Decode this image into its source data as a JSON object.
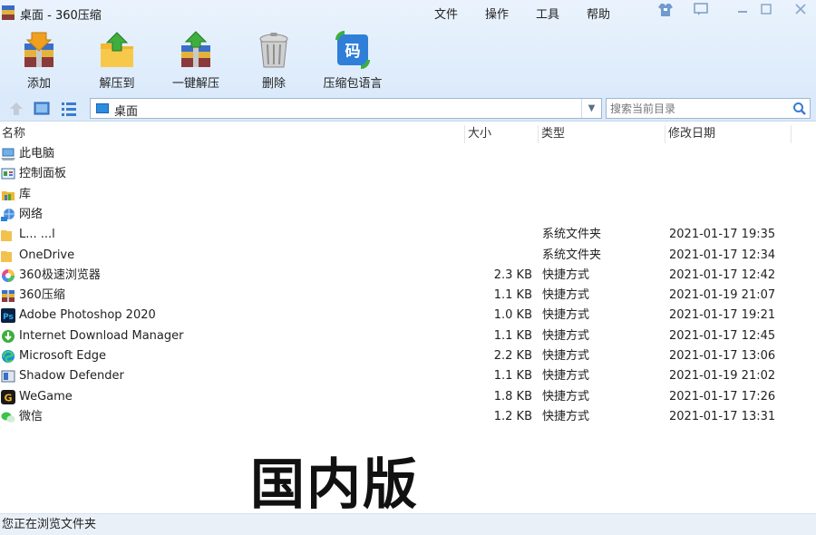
{
  "window": {
    "title": "桌面 - 360压缩"
  },
  "menu": [
    "文件",
    "操作",
    "工具",
    "帮助"
  ],
  "toolbar": [
    {
      "label": "添加",
      "icon": "archive-add-icon"
    },
    {
      "label": "解压到",
      "icon": "extract-folder-icon"
    },
    {
      "label": "一键解压",
      "icon": "one-click-extract-icon"
    },
    {
      "label": "删除",
      "icon": "trash-bin-icon"
    },
    {
      "label": "压缩包语言",
      "icon": "archive-language-icon",
      "badge": "码"
    }
  ],
  "address": {
    "path": "桌面",
    "search_placeholder": "搜索当前目录"
  },
  "columns": {
    "name": "名称",
    "size": "大小",
    "type": "类型",
    "date": "修改日期"
  },
  "files": [
    {
      "name": "此电脑",
      "size": "",
      "type": "",
      "date": "",
      "icon": "computer-icon"
    },
    {
      "name": "控制面板",
      "size": "",
      "type": "",
      "date": "",
      "icon": "control-panel-icon"
    },
    {
      "name": "库",
      "size": "",
      "type": "",
      "date": "",
      "icon": "library-icon"
    },
    {
      "name": "网络",
      "size": "",
      "type": "",
      "date": "",
      "icon": "network-icon"
    },
    {
      "name": "L... ...l",
      "size": "",
      "type": "系统文件夹",
      "date": "2021-01-17 19:35",
      "icon": "folder-icon"
    },
    {
      "name": "OneDrive",
      "size": "",
      "type": "系统文件夹",
      "date": "2021-01-17 12:34",
      "icon": "folder-icon"
    },
    {
      "name": "360极速浏览器",
      "size": "2.3 KB",
      "type": "快捷方式",
      "date": "2021-01-17 12:42",
      "icon": "360-browser-icon"
    },
    {
      "name": "360压缩",
      "size": "1.1 KB",
      "type": "快捷方式",
      "date": "2021-01-19 21:07",
      "icon": "360-zip-icon"
    },
    {
      "name": "Adobe Photoshop 2020",
      "size": "1.0 KB",
      "type": "快捷方式",
      "date": "2021-01-17 19:21",
      "icon": "photoshop-icon"
    },
    {
      "name": "Internet Download Manager",
      "size": "1.1 KB",
      "type": "快捷方式",
      "date": "2021-01-17 12:45",
      "icon": "idm-icon"
    },
    {
      "name": "Microsoft Edge",
      "size": "2.2 KB",
      "type": "快捷方式",
      "date": "2021-01-17 13:06",
      "icon": "edge-icon"
    },
    {
      "name": "Shadow Defender",
      "size": "1.1 KB",
      "type": "快捷方式",
      "date": "2021-01-19 21:02",
      "icon": "shadow-defender-icon"
    },
    {
      "name": "WeGame",
      "size": "1.8 KB",
      "type": "快捷方式",
      "date": "2021-01-17 17:26",
      "icon": "wegame-icon"
    },
    {
      "name": "微信",
      "size": "1.2 KB",
      "type": "快捷方式",
      "date": "2021-01-17 13:31",
      "icon": "wechat-icon"
    }
  ],
  "overlay_text": "国内版",
  "status": "您正在浏览文件夹"
}
